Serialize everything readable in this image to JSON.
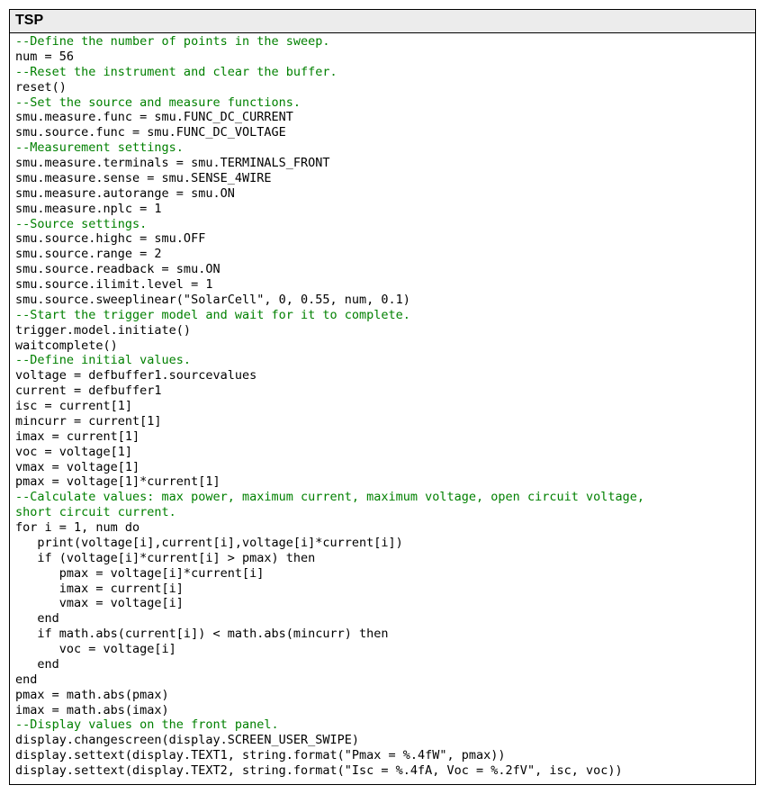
{
  "panel": {
    "title": "TSP"
  },
  "code": {
    "lines": [
      {
        "t": "c",
        "s": "--Define the number of points in the sweep."
      },
      {
        "t": "k",
        "s": "num = 56"
      },
      {
        "t": "c",
        "s": "--Reset the instrument and clear the buffer."
      },
      {
        "t": "k",
        "s": "reset()"
      },
      {
        "t": "c",
        "s": "--Set the source and measure functions."
      },
      {
        "t": "k",
        "s": "smu.measure.func = smu.FUNC_DC_CURRENT"
      },
      {
        "t": "k",
        "s": "smu.source.func = smu.FUNC_DC_VOLTAGE"
      },
      {
        "t": "c",
        "s": "--Measurement settings."
      },
      {
        "t": "k",
        "s": "smu.measure.terminals = smu.TERMINALS_FRONT"
      },
      {
        "t": "k",
        "s": "smu.measure.sense = smu.SENSE_4WIRE"
      },
      {
        "t": "k",
        "s": "smu.measure.autorange = smu.ON"
      },
      {
        "t": "k",
        "s": "smu.measure.nplc = 1"
      },
      {
        "t": "c",
        "s": "--Source settings."
      },
      {
        "t": "k",
        "s": "smu.source.highc = smu.OFF"
      },
      {
        "t": "k",
        "s": "smu.source.range = 2"
      },
      {
        "t": "k",
        "s": "smu.source.readback = smu.ON"
      },
      {
        "t": "k",
        "s": "smu.source.ilimit.level = 1"
      },
      {
        "t": "k",
        "s": "smu.source.sweeplinear(\"SolarCell\", 0, 0.55, num, 0.1)"
      },
      {
        "t": "c",
        "s": "--Start the trigger model and wait for it to complete."
      },
      {
        "t": "k",
        "s": "trigger.model.initiate()"
      },
      {
        "t": "k",
        "s": "waitcomplete()"
      },
      {
        "t": "c",
        "s": "--Define initial values."
      },
      {
        "t": "k",
        "s": "voltage = defbuffer1.sourcevalues"
      },
      {
        "t": "k",
        "s": "current = defbuffer1"
      },
      {
        "t": "k",
        "s": "isc = current[1]"
      },
      {
        "t": "k",
        "s": "mincurr = current[1]"
      },
      {
        "t": "k",
        "s": "imax = current[1]"
      },
      {
        "t": "k",
        "s": "voc = voltage[1]"
      },
      {
        "t": "k",
        "s": "vmax = voltage[1]"
      },
      {
        "t": "k",
        "s": "pmax = voltage[1]*current[1]"
      },
      {
        "t": "c",
        "s": "--Calculate values: max power, maximum current, maximum voltage, open circuit voltage,"
      },
      {
        "t": "c",
        "s": "short circuit current."
      },
      {
        "t": "k",
        "s": "for i = 1, num do"
      },
      {
        "t": "k",
        "s": "   print(voltage[i],current[i],voltage[i]*current[i])"
      },
      {
        "t": "k",
        "s": "   if (voltage[i]*current[i] > pmax) then"
      },
      {
        "t": "k",
        "s": "      pmax = voltage[i]*current[i]"
      },
      {
        "t": "k",
        "s": "      imax = current[i]"
      },
      {
        "t": "k",
        "s": "      vmax = voltage[i]"
      },
      {
        "t": "k",
        "s": "   end"
      },
      {
        "t": "k",
        "s": "   if math.abs(current[i]) < math.abs(mincurr) then"
      },
      {
        "t": "k",
        "s": "      voc = voltage[i]"
      },
      {
        "t": "k",
        "s": "   end"
      },
      {
        "t": "k",
        "s": "end"
      },
      {
        "t": "k",
        "s": "pmax = math.abs(pmax)"
      },
      {
        "t": "k",
        "s": "imax = math.abs(imax)"
      },
      {
        "t": "c",
        "s": "--Display values on the front panel."
      },
      {
        "t": "k",
        "s": "display.changescreen(display.SCREEN_USER_SWIPE)"
      },
      {
        "t": "k",
        "s": "display.settext(display.TEXT1, string.format(\"Pmax = %.4fW\", pmax))"
      },
      {
        "t": "k",
        "s": "display.settext(display.TEXT2, string.format(\"Isc = %.4fA, Voc = %.2fV\", isc, voc))"
      }
    ]
  }
}
